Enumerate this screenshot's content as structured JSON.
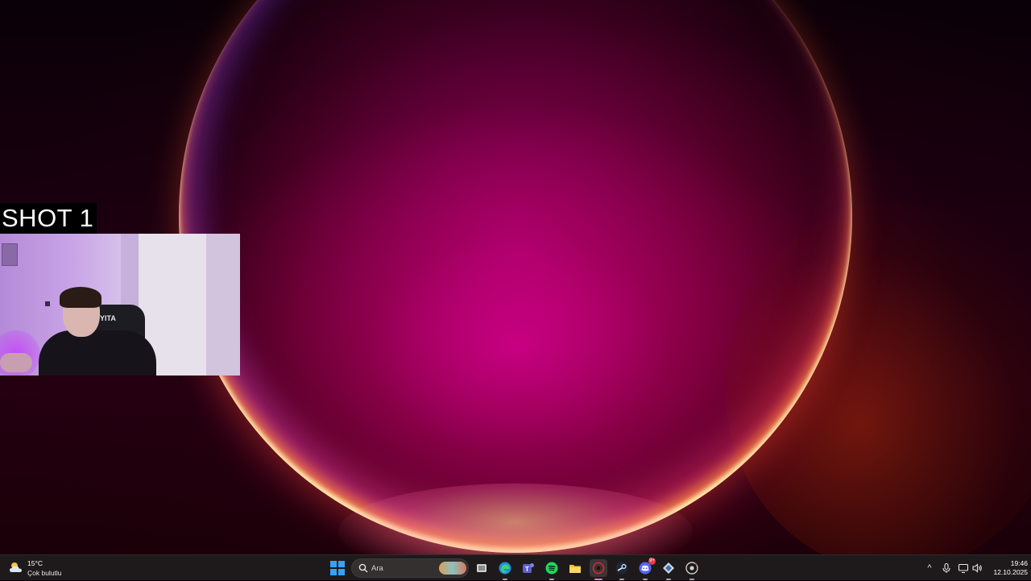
{
  "overlay": {
    "shot_label": "SHOT 1",
    "webcam_chair_text": "YITA"
  },
  "taskbar": {
    "weather": {
      "temp": "15°C",
      "desc": "Çok bulutlu",
      "icon": "cloud-sun-icon"
    },
    "search": {
      "placeholder": "Ara"
    },
    "apps": [
      {
        "name": "task-view",
        "icon": "task-view-icon"
      },
      {
        "name": "edge",
        "icon": "edge-icon"
      },
      {
        "name": "teams",
        "icon": "teams-icon"
      },
      {
        "name": "spotify",
        "icon": "spotify-icon"
      },
      {
        "name": "file-explorer",
        "icon": "folder-icon"
      },
      {
        "name": "obs",
        "icon": "record-icon",
        "active": true
      },
      {
        "name": "steam",
        "icon": "steam-icon"
      },
      {
        "name": "discord",
        "icon": "discord-icon",
        "badge": "9+"
      },
      {
        "name": "game-launcher",
        "icon": "diamond-app-icon"
      },
      {
        "name": "chrome",
        "icon": "chrome-icon"
      }
    ],
    "tray": {
      "chevron": "^",
      "icons": [
        "microphone-icon",
        "display-icon",
        "speaker-icon"
      ]
    },
    "clock": {
      "time": "19:46",
      "date": "12.10.2025"
    }
  },
  "colors": {
    "taskbar_bg": "#1e1a1c",
    "accent_active": "#e07cc4",
    "start_blue": "#3aa0f0"
  }
}
